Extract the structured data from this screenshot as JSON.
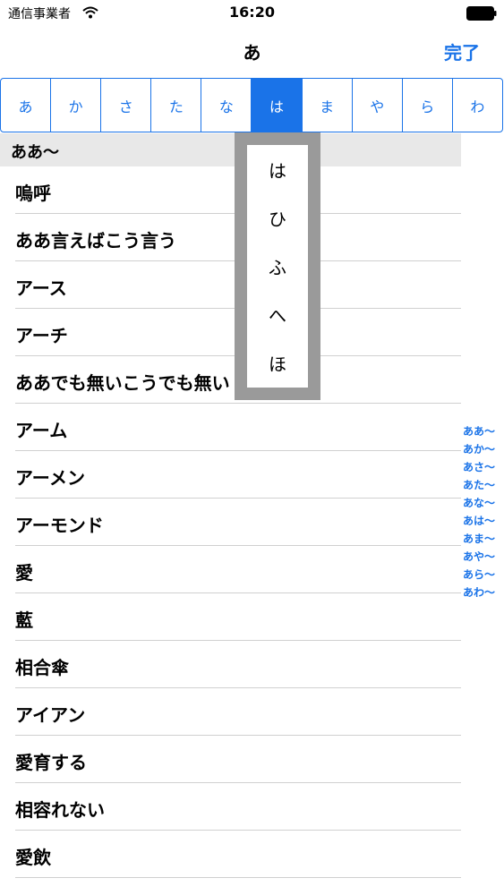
{
  "status_bar": {
    "carrier": "通信事業者",
    "time": "16:20"
  },
  "nav": {
    "title": "あ",
    "done_label": "完了"
  },
  "segments": [
    "あ",
    "か",
    "さ",
    "た",
    "な",
    "は",
    "ま",
    "や",
    "ら",
    "わ"
  ],
  "selected_segment": "は",
  "section_header": "ああ〜",
  "rows": [
    "嗚呼",
    "ああ言えばこう言う",
    "アース",
    "アーチ",
    "ああでも無いこうでも無い",
    "アーム",
    "アーメン",
    "アーモンド",
    "愛",
    "藍",
    "相合傘",
    "アイアン",
    "愛育する",
    "相容れない",
    "愛飲"
  ],
  "index_items": [
    "ああ〜",
    "あか〜",
    "あさ〜",
    "あた〜",
    "あな〜",
    "あは〜",
    "あま〜",
    "あや〜",
    "あら〜",
    "あわ〜"
  ],
  "popup_items": [
    "は",
    "ひ",
    "ふ",
    "へ",
    "ほ"
  ],
  "colors": {
    "accent": "#1a73e8",
    "section_bg": "#e8e8e8",
    "popup_border": "#9a9a9a"
  }
}
